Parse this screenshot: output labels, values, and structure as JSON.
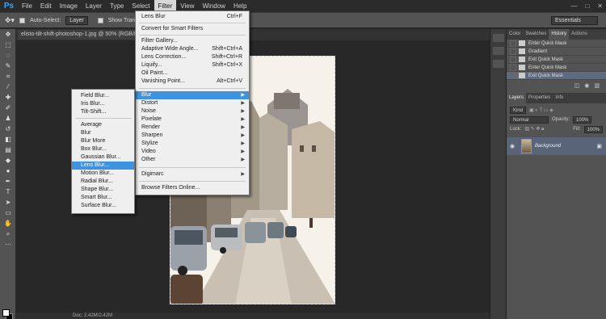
{
  "app": {
    "logo": "Ps"
  },
  "menubar": {
    "items": [
      "File",
      "Edit",
      "Image",
      "Layer",
      "Type",
      "Select",
      "Filter",
      "View",
      "Window",
      "Help"
    ],
    "active": "Filter",
    "window_controls": [
      "—",
      "□",
      "✕"
    ]
  },
  "options_bar": {
    "auto_select_label": "Auto-Select:",
    "auto_select_value": "Layer",
    "show_transform_label": "Show Tran",
    "workspace": "Essentials"
  },
  "document": {
    "tab_title": "elisto-tilt-shift-photoshop-1.jpg @ 50% (RGB/8",
    "status": "Doc: 2.42M/2.42M"
  },
  "filter_menu": {
    "last_filter": {
      "label": "Lens Blur",
      "shortcut": "Ctrl+F"
    },
    "convert": "Convert for Smart Filters",
    "group1": [
      {
        "label": "Filter Gallery...",
        "shortcut": ""
      },
      {
        "label": "Adaptive Wide Angle...",
        "shortcut": "Shift+Ctrl+A"
      },
      {
        "label": "Lens Correction...",
        "shortcut": "Shift+Ctrl+R"
      },
      {
        "label": "Liquify...",
        "shortcut": "Shift+Ctrl+X"
      },
      {
        "label": "Oil Paint...",
        "shortcut": ""
      },
      {
        "label": "Vanishing Point...",
        "shortcut": "Alt+Ctrl+V"
      }
    ],
    "submenus": [
      "Blur",
      "Distort",
      "Noise",
      "Pixelate",
      "Render",
      "Sharpen",
      "Stylize",
      "Video",
      "Other"
    ],
    "highlighted": "Blur",
    "digimarc": "Digimarc",
    "browse": "Browse Filters Online..."
  },
  "blur_menu": {
    "group1": [
      "Field Blur...",
      "Iris Blur...",
      "Tilt-Shift..."
    ],
    "group2": [
      "Average",
      "Blur",
      "Blur More",
      "Box Blur...",
      "Gaussian Blur...",
      "Lens Blur...",
      "Motion Blur...",
      "Radial Blur...",
      "Shape Blur...",
      "Smart Blur...",
      "Surface Blur..."
    ],
    "highlighted": "Lens Blur..."
  },
  "history_panel": {
    "tabs": [
      "Color",
      "Swatches",
      "History",
      "Actions"
    ],
    "active_tab": "History",
    "items": [
      "Enter Quick Mask",
      "Gradient",
      "Exit Quick Mask",
      "Enter Quick Mask",
      "Exit Quick Mask"
    ],
    "selected_index": 4
  },
  "layers_panel": {
    "tabs": [
      "Layers",
      "Properties",
      "Info"
    ],
    "active_tab": "Layers",
    "kind_label": "Kind",
    "blend_mode": "Normal",
    "opacity_label": "Opacity:",
    "opacity_value": "100%",
    "lock_label": "Lock:",
    "fill_label": "Fill:",
    "fill_value": "100%",
    "layers": [
      {
        "name": "Background",
        "locked": true
      }
    ]
  },
  "colors": {
    "highlight": "#3d93e0",
    "ps_blue": "#31a8ff"
  }
}
